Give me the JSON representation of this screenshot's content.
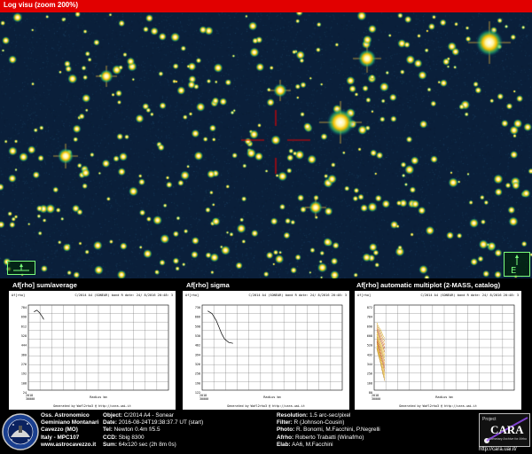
{
  "header": {
    "title": "Log visu (zoom 200%)"
  },
  "panels": [
    {
      "title": "Af[rho] sum/average",
      "top_left": "Af[rho]",
      "top_center": "C/2014 A4 (SONEAR)",
      "top_right": "band R date: 24/ 8/2016 20:48: 3",
      "y_ticks": [
        "784",
        "696",
        "612",
        "528",
        "444",
        "360",
        "276",
        "192",
        "108",
        "24"
      ],
      "x_ticks": [
        "2018",
        "30000"
      ],
      "x_label": "Radius km",
      "footer": "Generated by Wafl2rho3 @ http://cara.uai.it",
      "curve": [
        [
          0.04,
          0.92
        ],
        [
          0.06,
          0.94
        ],
        [
          0.08,
          0.91
        ],
        [
          0.1,
          0.86
        ],
        [
          0.11,
          0.83
        ]
      ]
    },
    {
      "title": "Af[rho] sigma",
      "top_left": "Af[rho]",
      "top_center": "C/2014 A4 (SONEAR)",
      "top_right": "band R date: 24/ 8/2016 20:48: 3",
      "y_ticks": [
        "730",
        "666",
        "598",
        "530",
        "462",
        "394",
        "326",
        "258",
        "190",
        "122"
      ],
      "x_ticks": [
        "2018",
        "30000"
      ],
      "x_label": "Radius km",
      "footer": "Generated by Wafl2rho3 @ http://cara.uai.it",
      "curve": [
        [
          0.04,
          0.93
        ],
        [
          0.07,
          0.9
        ],
        [
          0.1,
          0.82
        ],
        [
          0.12,
          0.74
        ],
        [
          0.14,
          0.66
        ],
        [
          0.16,
          0.6
        ],
        [
          0.19,
          0.56
        ],
        [
          0.22,
          0.55
        ]
      ]
    },
    {
      "title": "Af[rho] automatic multiplot (2-MASS, catalog)",
      "top_left": "Af[rho]",
      "top_center": "C/2014 A4 (SONEAR)",
      "top_right": "band R date: 24/ 8/2016 20:48: 3",
      "y_ticks": [
        "872",
        "784",
        "696",
        "608",
        "520",
        "432",
        "344",
        "256",
        "168",
        "80"
      ],
      "x_ticks": [
        "2018",
        "30000"
      ],
      "x_label": "Radius km",
      "footer": "Generated by Wafl2rho3 @ http://cara.uai.it",
      "curve": []
    }
  ],
  "observatory": {
    "line1": "Oss. Astronomico",
    "line2": "Geminiano Montanari",
    "line3": "Cavezzo (MO)",
    "line4": "Italy - MPC107",
    "line5": "www.astrocavezzo.it"
  },
  "obs_info": [
    {
      "k": "Object:",
      "v": "C/2014 A4 - Sonear"
    },
    {
      "k": "Date:",
      "v": "2016-08-24T19:38:37.7 UT (start)"
    },
    {
      "k": "Tel:",
      "v": "Newton 0.4m f/5.5"
    },
    {
      "k": "CCD:",
      "v": "Sbig 8300"
    },
    {
      "k": "Sum:",
      "v": "64x120 sec (2h 8m 0s)"
    }
  ],
  "proc_info": [
    {
      "k": "Resolution:",
      "v": "1.5 arc-sec/pixel"
    },
    {
      "k": "Filter:",
      "v": "R (Johnson-Cousin)"
    },
    {
      "k": "Photo:",
      "v": "R. Bonomi, M.Facchini, P.Negrelli"
    },
    {
      "k": "Afrho:",
      "v": "Roberto Trabatti (Winafrho)"
    },
    {
      "k": "Elab:",
      "v": "AA6, M.Facchini"
    }
  ],
  "cara": {
    "project": "Project",
    "name": "CARA",
    "subtitle": "Cometary Archive for Afrho",
    "url": "http://cara.uai.it/"
  },
  "colors": {
    "title_bar": "#e10000",
    "sky": "#0a1f3a",
    "star_core": "#ffffff",
    "star_halo": "#f6c000",
    "nav": "#7cff7c"
  }
}
